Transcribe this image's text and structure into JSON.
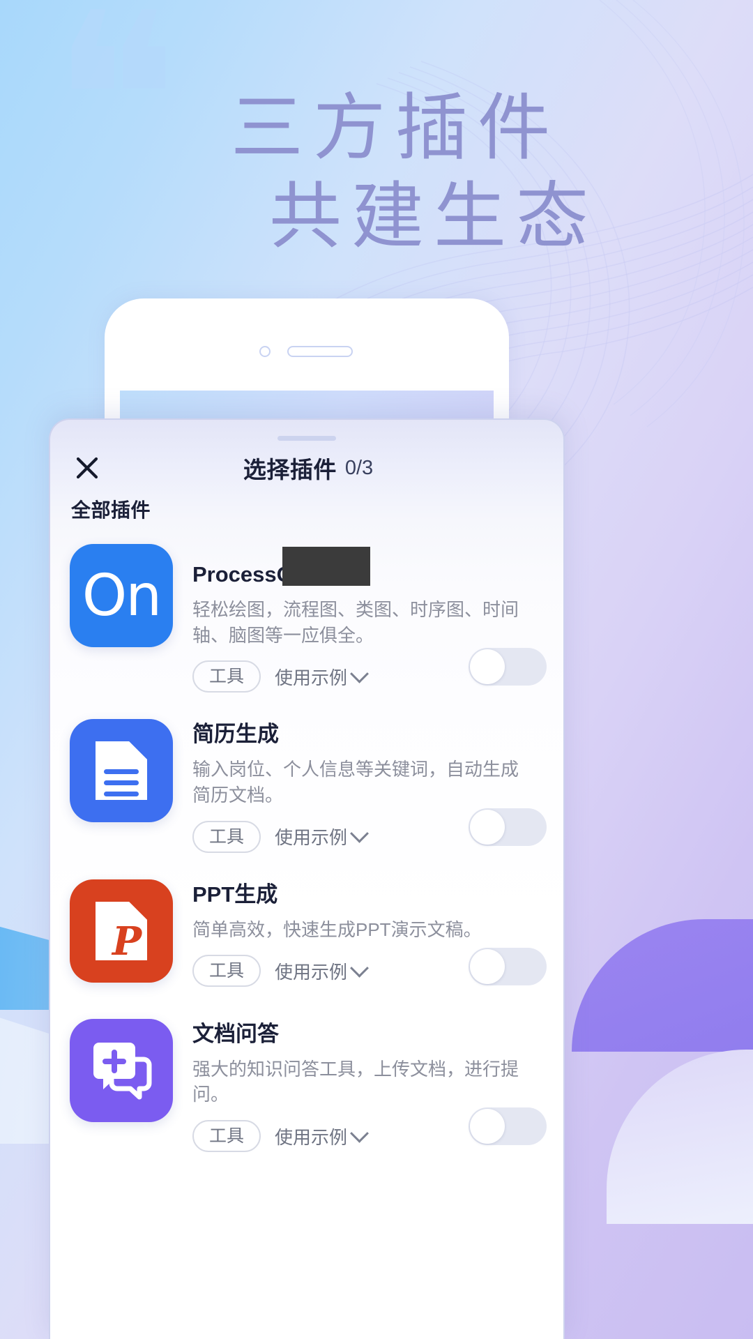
{
  "banner": {
    "line1": "三方插件",
    "line2": "共建生态",
    "quote_glyph": "❝"
  },
  "sheet": {
    "handle": "drag-handle",
    "close_label": "✕",
    "title": "选择插件",
    "count": "0/3",
    "section_label": "全部插件"
  },
  "colors": {
    "accent_blue": "#2a7ff0",
    "resume_blue": "#3d6ff0",
    "ppt_orange": "#d8411f",
    "doc_purple": "#7b5cf0",
    "banner_text": "#8f93d0",
    "toggle_track": "#e4e7f2"
  },
  "plugins": [
    {
      "name": "ProcessO",
      "name_redacted": true,
      "icon": "processon-on-icon",
      "icon_glyph": "On",
      "icon_bg": "#2a7ff0",
      "desc": "轻松绘图，流程图、类图、时序图、时间轴、脑图等一应俱全。",
      "tag": "工具",
      "example_label": "使用示例",
      "toggle_state": "off"
    },
    {
      "name": "简历生成",
      "name_redacted": false,
      "icon": "document-lines-icon",
      "icon_glyph": "",
      "icon_bg": "#3d6ff0",
      "desc": "输入岗位、个人信息等关键词，自动生成简历文档。",
      "tag": "工具",
      "example_label": "使用示例",
      "toggle_state": "off"
    },
    {
      "name": "PPT生成",
      "name_redacted": false,
      "icon": "powerpoint-file-icon",
      "icon_glyph": "P",
      "icon_bg": "#d8411f",
      "desc": "简单高效，快速生成PPT演示文稿。",
      "tag": "工具",
      "example_label": "使用示例",
      "toggle_state": "off"
    },
    {
      "name": "文档问答",
      "name_redacted": false,
      "icon": "chat-bubble-plus-icon",
      "icon_glyph": "",
      "icon_bg": "#7b5cf0",
      "desc": "强大的知识问答工具，上传文档，进行提问。",
      "tag": "工具",
      "example_label": "使用示例",
      "toggle_state": "off"
    }
  ]
}
